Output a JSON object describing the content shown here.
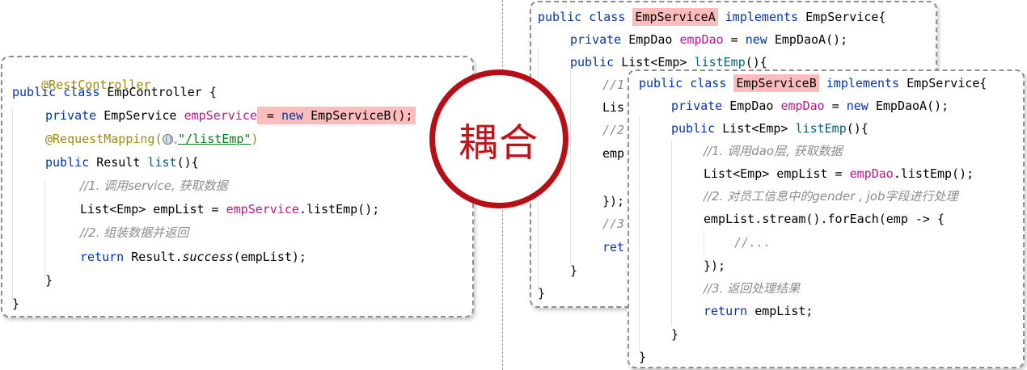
{
  "coupling_label": "耦合",
  "colors": {
    "highlight": "#fdbcbc",
    "circle": "#b80f16",
    "keyword": "#0033b3",
    "field": "#c0148c",
    "comment": "#8c8c8c",
    "annotation": "#9e880d",
    "string": "#067d17"
  },
  "controller": {
    "annotation": "@RestController",
    "kw_public_class": "public class ",
    "class_name": "EmpController {",
    "kw_private": "private ",
    "field_type": "EmpService ",
    "field_name": "empService",
    "hl_assign": " = ",
    "hl_new": "new ",
    "hl_impl": "EmpServiceB();",
    "mapping_start": "@RequestMapping(",
    "mapping_chevron": "⌄",
    "mapping_path": "\"/listEmp\"",
    "mapping_end": ")",
    "kw_public": "public ",
    "method_type": "Result ",
    "method_name": "list",
    "method_end": "(){",
    "comment1": "//1. 调用service, 获取数据",
    "list_decl": "List<Emp> empList = ",
    "list_field": "empService",
    "list_call": ".listEmp();",
    "comment2": "//2. 组装数据并返回",
    "kw_return": "return ",
    "return_obj": "Result.",
    "return_method": "success",
    "return_args": "(empList);",
    "close_method": "}",
    "close_class": "}"
  },
  "service_a": {
    "kw_public_class": "public class ",
    "class_name": "EmpServiceA",
    "kw_implements": " implements ",
    "interface": "EmpService{",
    "kw_private": "private ",
    "dao_type": "EmpDao ",
    "dao_field": "empDao",
    "assign": " = ",
    "kw_new": "new ",
    "dao_impl": "EmpDaoA();",
    "kw_public": "public ",
    "ret_type": "List<Emp> ",
    "method_name": "listEmp",
    "method_end": "(){",
    "peek_comment1": "//1",
    "peek_list": "Lis",
    "peek_comment2": "//2",
    "peek_emp": "emp",
    "peek_close": "});",
    "peek_comment3": "//3",
    "peek_ret": "ret",
    "close_method": "}",
    "close_class": "}"
  },
  "service_b": {
    "kw_public_class": "public class ",
    "class_name": "EmpServiceB",
    "kw_implements": " implements ",
    "interface": "EmpService{",
    "kw_private": "private ",
    "dao_type": "EmpDao ",
    "dao_field": "empDao",
    "assign": " = ",
    "kw_new": "new ",
    "dao_impl": "EmpDaoA();",
    "kw_public": "public ",
    "ret_type": "List<Emp> ",
    "method_name": "listEmp",
    "method_end": "(){",
    "comment1": "//1. 调用dao层, 获取数据",
    "list_decl": "List<Emp> empList = ",
    "list_field": "empDao",
    "list_call": ".listEmp();",
    "comment2": "//2. 对员工信息中的gender , job字段进行处理",
    "stream": "empList.stream().forEach(emp -> {",
    "inner_comment": "//...",
    "stream_close": "});",
    "comment3": "//3. 返回处理结果",
    "kw_return": "return ",
    "return_val": "empList;",
    "close_method": "}",
    "close_class": "}"
  }
}
